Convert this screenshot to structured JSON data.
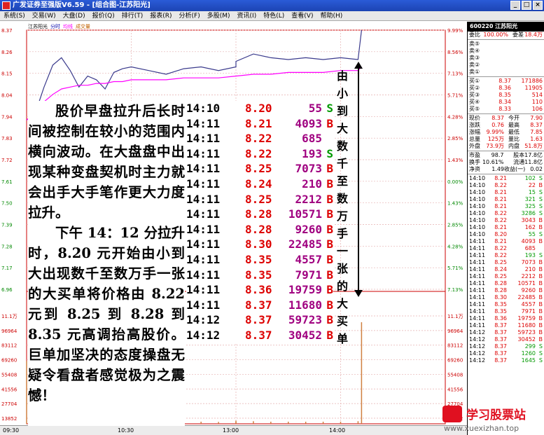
{
  "window": {
    "title": "广发证券至强版V6.59 - [组合图-江苏阳光]",
    "buttons": [
      "_",
      "□",
      "×"
    ]
  },
  "menu": [
    "系统(S)",
    "交易(W)",
    "大盘(D)",
    "报价(Q)",
    "排行(T)",
    "报表(R)",
    "分析(F)",
    "多股(M)",
    "资讯(I)",
    "特色(L)",
    "查看(V)",
    "帮助(H)"
  ],
  "chart": {
    "stock_name": "江苏阳光",
    "legend": [
      "分时",
      "均线",
      "成交量"
    ],
    "legend_colors": [
      "#0000aa",
      "#ff00ff",
      "#c06000"
    ],
    "price_ticks": [
      "8.37",
      "8.26",
      "8.15",
      "8.04",
      "7.94",
      "7.83",
      "7.72",
      "7.61",
      "7.50",
      "7.39",
      "7.28",
      "7.17",
      "6.96"
    ],
    "pct_ticks": [
      "9.99%",
      "8.56%",
      "7.13%",
      "5.71%",
      "4.28%",
      "2.85%",
      "1.43%",
      "0.00%",
      "1.43%",
      "2.85%",
      "4.28%",
      "5.71%",
      "7.13%"
    ],
    "vol_ticks": [
      "11.1万",
      "96964",
      "83112",
      "69260",
      "55408",
      "41556",
      "27704",
      "13852"
    ],
    "time_ticks": [
      "09:30",
      "10:30",
      "13:00",
      "14:00"
    ],
    "price_color": "#3a3a8c",
    "avg_color": "#ff00ff",
    "volume_color": "#d08040"
  },
  "chart_data": {
    "type": "line",
    "x": [
      "09:30",
      "09:35",
      "09:40",
      "09:45",
      "09:50",
      "09:55",
      "10:00",
      "10:05",
      "10:10",
      "10:15",
      "10:20",
      "10:25",
      "10:30",
      "10:40",
      "10:50",
      "11:00",
      "11:10",
      "11:20",
      "11:30",
      "13:00",
      "13:10",
      "13:20",
      "13:30",
      "13:40",
      "13:50",
      "14:00",
      "14:10",
      "14:12"
    ],
    "series": [
      {
        "name": "分时",
        "values": [
          7.88,
          7.92,
          8.06,
          8.18,
          8.22,
          8.15,
          8.06,
          8.12,
          8.1,
          8.05,
          8.14,
          8.16,
          8.17,
          8.15,
          8.13,
          8.16,
          8.17,
          8.15,
          8.17,
          8.2,
          8.24,
          8.22,
          8.21,
          8.22,
          8.21,
          8.22,
          8.21,
          8.37
        ]
      },
      {
        "name": "均线",
        "values": [
          7.88,
          7.93,
          7.98,
          8.02,
          8.05,
          8.06,
          8.07,
          8.07,
          8.08,
          8.08,
          8.09,
          8.09,
          8.1,
          8.1,
          8.1,
          8.11,
          8.11,
          8.11,
          8.12,
          8.12,
          8.13,
          8.13,
          8.14,
          8.14,
          8.14,
          8.15,
          8.15,
          8.17
        ]
      }
    ],
    "ylim": [
      6.96,
      8.37
    ],
    "volume": {
      "values": [
        60000,
        22000,
        18000,
        12000,
        9000,
        6000,
        5000,
        4000,
        4000,
        3500,
        3000,
        3000,
        2500,
        2500,
        2000,
        2000,
        2000,
        1800,
        1800,
        3000,
        2500,
        2000,
        2000,
        2000,
        2000,
        2000,
        2500,
        96964
      ],
      "ylim": [
        0,
        111000
      ]
    }
  },
  "overlay_text": {
    "para1": "股价早盘拉升后长时间被控制在较小的范围内横向波动。在大盘盘中出现某种变盘契机时主力就会出手大手笔作更大力度拉升。",
    "para2": "下午 14：12 分拉升时，8.20 元开始由小到大出现数千至数万手一张的大买单将价格由 8.22 元到 8.25 到 8.28 到 8.35 元高调抬高股价。巨单加坚决的态度操盘无疑令看盘者感觉极为之震憾！"
  },
  "trade_table": {
    "rows": [
      {
        "time": "14:10",
        "price": "8.20",
        "vol": "55",
        "bs": "S"
      },
      {
        "time": "14:11",
        "price": "8.21",
        "vol": "4093",
        "bs": "B"
      },
      {
        "time": "14:11",
        "price": "8.22",
        "vol": "685",
        "bs": ""
      },
      {
        "time": "14:11",
        "price": "8.22",
        "vol": "193",
        "bs": "S"
      },
      {
        "time": "14:11",
        "price": "8.25",
        "vol": "7073",
        "bs": "B"
      },
      {
        "time": "14:11",
        "price": "8.24",
        "vol": "210",
        "bs": "B"
      },
      {
        "time": "14:11",
        "price": "8.25",
        "vol": "2212",
        "bs": "B"
      },
      {
        "time": "14:11",
        "price": "8.28",
        "vol": "10571",
        "bs": "B"
      },
      {
        "time": "14:11",
        "price": "8.28",
        "vol": "9260",
        "bs": "B"
      },
      {
        "time": "14:11",
        "price": "8.30",
        "vol": "22485",
        "bs": "B"
      },
      {
        "time": "14:11",
        "price": "8.35",
        "vol": "4557",
        "bs": "B"
      },
      {
        "time": "14:11",
        "price": "8.35",
        "vol": "7971",
        "bs": "B"
      },
      {
        "time": "14:11",
        "price": "8.36",
        "vol": "19759",
        "bs": "B"
      },
      {
        "time": "14:11",
        "price": "8.37",
        "vol": "11680",
        "bs": "B"
      },
      {
        "time": "14:12",
        "price": "8.37",
        "vol": "59723",
        "bs": "B"
      },
      {
        "time": "14:12",
        "price": "8.37",
        "vol": "30452",
        "bs": "B"
      }
    ]
  },
  "vertical_label": [
    "由",
    "小",
    "到",
    "大",
    "数",
    "千",
    "至",
    "数",
    "万",
    "手",
    "一",
    "张",
    "的",
    "大",
    "买",
    "单"
  ],
  "side_panel": {
    "code_name": "600220 江苏阳光",
    "weibi": {
      "label": "委比",
      "value": "100.00%",
      "label2": "委差",
      "value2": "18.4万"
    },
    "sell": [
      {
        "label": "卖⑤",
        "price": "",
        "vol": ""
      },
      {
        "label": "卖④",
        "price": "",
        "vol": ""
      },
      {
        "label": "卖③",
        "price": "",
        "vol": ""
      },
      {
        "label": "卖②",
        "price": "",
        "vol": ""
      },
      {
        "label": "卖①",
        "price": "",
        "vol": ""
      }
    ],
    "buy": [
      {
        "label": "买①",
        "price": "8.37",
        "vol": "171886"
      },
      {
        "label": "买②",
        "price": "8.36",
        "vol": "11905"
      },
      {
        "label": "买③",
        "price": "8.35",
        "vol": "514"
      },
      {
        "label": "买④",
        "price": "8.34",
        "vol": "110"
      },
      {
        "label": "买⑤",
        "price": "8.33",
        "vol": "106"
      }
    ],
    "stats": [
      {
        "l1": "现价",
        "v1": "8.37",
        "l2": "今开",
        "v2": "7.90"
      },
      {
        "l1": "涨跌",
        "v1": "0.76",
        "l2": "最高",
        "v2": "8.37"
      },
      {
        "l1": "涨幅",
        "v1": "9.99%",
        "l2": "最低",
        "v2": "7.85"
      },
      {
        "l1": "总量",
        "v1": "125万",
        "l2": "量比",
        "v2": "1.63"
      },
      {
        "l1": "外盘",
        "v1": "73.9万",
        "l2": "内盘",
        "v2": "51.8万"
      }
    ],
    "stats2": [
      {
        "l1": "市盈",
        "v1": "98.7",
        "l2": "股本",
        "v2": "17.8亿"
      },
      {
        "l1": "换手",
        "v1": "10.61%",
        "l2": "流通",
        "v2": "11.8亿"
      },
      {
        "l1": "净资",
        "v1": "1.49",
        "l2": "收益(一)",
        "v2": "0.02"
      }
    ],
    "ticks": [
      {
        "t": "14:10",
        "p": "8.21",
        "v": "102",
        "bs": "S"
      },
      {
        "t": "14:10",
        "p": "8.22",
        "v": "22",
        "bs": "B"
      },
      {
        "t": "14:10",
        "p": "8.21",
        "v": "15",
        "bs": "S"
      },
      {
        "t": "14:10",
        "p": "8.21",
        "v": "321",
        "bs": "S"
      },
      {
        "t": "14:10",
        "p": "8.21",
        "v": "325",
        "bs": "S"
      },
      {
        "t": "14:10",
        "p": "8.22",
        "v": "3286",
        "bs": "S"
      },
      {
        "t": "14:10",
        "p": "8.22",
        "v": "3043",
        "bs": "B"
      },
      {
        "t": "14:10",
        "p": "8.21",
        "v": "162",
        "bs": "B"
      },
      {
        "t": "14:10",
        "p": "8.20",
        "v": "55",
        "bs": "S"
      },
      {
        "t": "14:11",
        "p": "8.21",
        "v": "4093",
        "bs": "B"
      },
      {
        "t": "14:11",
        "p": "8.22",
        "v": "685",
        "bs": ""
      },
      {
        "t": "14:11",
        "p": "8.22",
        "v": "193",
        "bs": "S"
      },
      {
        "t": "14:11",
        "p": "8.25",
        "v": "7073",
        "bs": "B"
      },
      {
        "t": "14:11",
        "p": "8.24",
        "v": "210",
        "bs": "B"
      },
      {
        "t": "14:11",
        "p": "8.25",
        "v": "2212",
        "bs": "B"
      },
      {
        "t": "14:11",
        "p": "8.28",
        "v": "10571",
        "bs": "B"
      },
      {
        "t": "14:11",
        "p": "8.28",
        "v": "9260",
        "bs": "B"
      },
      {
        "t": "14:11",
        "p": "8.30",
        "v": "22485",
        "bs": "B"
      },
      {
        "t": "14:11",
        "p": "8.35",
        "v": "4557",
        "bs": "B"
      },
      {
        "t": "14:11",
        "p": "8.35",
        "v": "7971",
        "bs": "B"
      },
      {
        "t": "14:11",
        "p": "8.36",
        "v": "19759",
        "bs": "B"
      },
      {
        "t": "14:11",
        "p": "8.37",
        "v": "11680",
        "bs": "B"
      },
      {
        "t": "14:12",
        "p": "8.37",
        "v": "59723",
        "bs": "B"
      },
      {
        "t": "14:12",
        "p": "8.37",
        "v": "30452",
        "bs": "B"
      },
      {
        "t": "14:12",
        "p": "8.37",
        "v": "299",
        "bs": "S"
      },
      {
        "t": "14:12",
        "p": "8.37",
        "v": "1260",
        "bs": "S"
      },
      {
        "t": "14:12",
        "p": "8.37",
        "v": "1645",
        "bs": "S"
      }
    ]
  },
  "watermark": {
    "brand": "学习股票站",
    "url": "www.xuexizhan.top"
  }
}
